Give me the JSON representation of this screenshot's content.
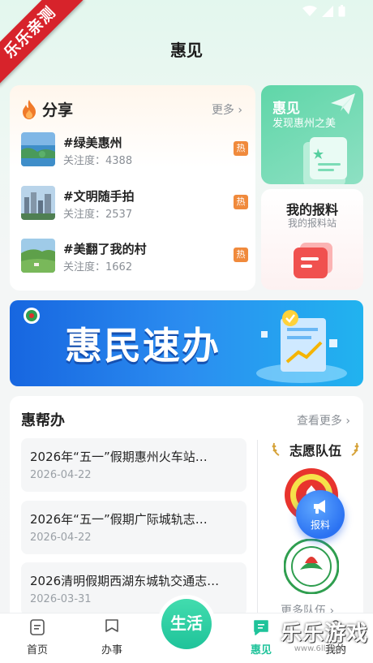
{
  "watermark": {
    "ribbon": "乐乐亲测",
    "brand": "乐乐游戏",
    "site": "www.6ll.com"
  },
  "header": {
    "title": "惠见"
  },
  "share": {
    "title": "分享",
    "more": "更多 ›",
    "items": [
      {
        "title": "#绿美惠州",
        "views": "关注度：4388",
        "badge": "热"
      },
      {
        "title": "#文明随手拍",
        "views": "关注度：2537",
        "badge": "热"
      },
      {
        "title": "#美翻了我的村",
        "views": "关注度：1662",
        "badge": "热"
      }
    ]
  },
  "discover": {
    "title": "惠见",
    "subtitle": "发现惠州之美"
  },
  "report": {
    "title": "我的报料",
    "subtitle": "我的报料站"
  },
  "banner": {
    "text": "惠民速办"
  },
  "help": {
    "title": "惠帮办",
    "more": "查看更多 ›",
    "items": [
      {
        "title": "2026年“五一”假期惠州火车站…",
        "date": "2026-04-22"
      },
      {
        "title": "2026年“五一”假期广际城轨志…",
        "date": "2026-04-22"
      },
      {
        "title": "2026清明假期西湖东城轨交通志…",
        "date": "2026-03-31"
      }
    ]
  },
  "volunteer": {
    "title": "志愿队伍",
    "more": "更多队伍 ›"
  },
  "float_button": {
    "label": "报料"
  },
  "tabs": [
    {
      "label": "首页",
      "icon": "home-icon"
    },
    {
      "label": "办事",
      "icon": "flag-icon"
    },
    {
      "label": "生活",
      "icon": "life-center-icon"
    },
    {
      "label": "惠见",
      "icon": "chat-icon",
      "active": true
    },
    {
      "label": "我的",
      "icon": "user-icon"
    }
  ],
  "colors": {
    "accent": "#1fc39a",
    "hot": "#f08a3c",
    "banner": "#1766e0"
  }
}
